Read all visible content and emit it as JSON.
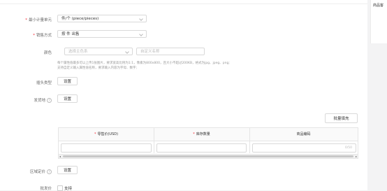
{
  "side": {
    "title": "商品客"
  },
  "form": {
    "min_unit": {
      "label": "最小计量单元",
      "value": "件/个 (piece/pieces)"
    },
    "sale_mode": {
      "label": "销售方式",
      "value": "按 件 出售"
    },
    "color": {
      "label": "颜色",
      "select_placeholder": "选择主色系",
      "custom_placeholder": "自定义名称",
      "hint_line1": "每个属性值最多可以上传1张图片，要求宽高比例为1:1，像素为800x800，且大小不超过200KB，格式为jpg、jpeg、png;",
      "hint_line2": "支持自定义输入属性值名称，要求输入内容为字母、数字;"
    },
    "plug_type": {
      "label": "插头类型",
      "button": "设置"
    },
    "ship_from": {
      "label": "发货地",
      "help": "?",
      "button": "设置"
    },
    "batch_fill": "批量填充",
    "table": {
      "col1": "零售价(USD)",
      "col2": "库存数量",
      "col3": "商品编码",
      "counter": "0/50"
    },
    "region_price": {
      "label": "区域定价",
      "help": "?",
      "button": "设置"
    },
    "wholesale": {
      "label": "批发价",
      "option": "支持"
    }
  }
}
